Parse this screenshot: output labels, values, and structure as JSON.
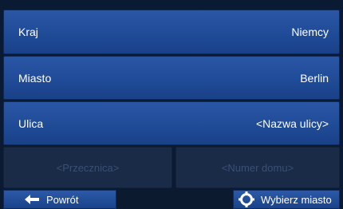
{
  "fields": [
    {
      "label": "Kraj",
      "value": "Niemcy"
    },
    {
      "label": "Miasto",
      "value": "Berlin"
    },
    {
      "label": "Ulica",
      "value": "<Nazwa ulicy>"
    }
  ],
  "secondary": {
    "intersection_placeholder": "<Przecznica>",
    "house_number_placeholder": "<Numer domu>"
  },
  "bottom_bar": {
    "back_label": "Powrót",
    "back_icon": "arrow-left-icon",
    "select_city_label": "Wybierz miasto",
    "select_city_icon": "crosshair-icon"
  }
}
